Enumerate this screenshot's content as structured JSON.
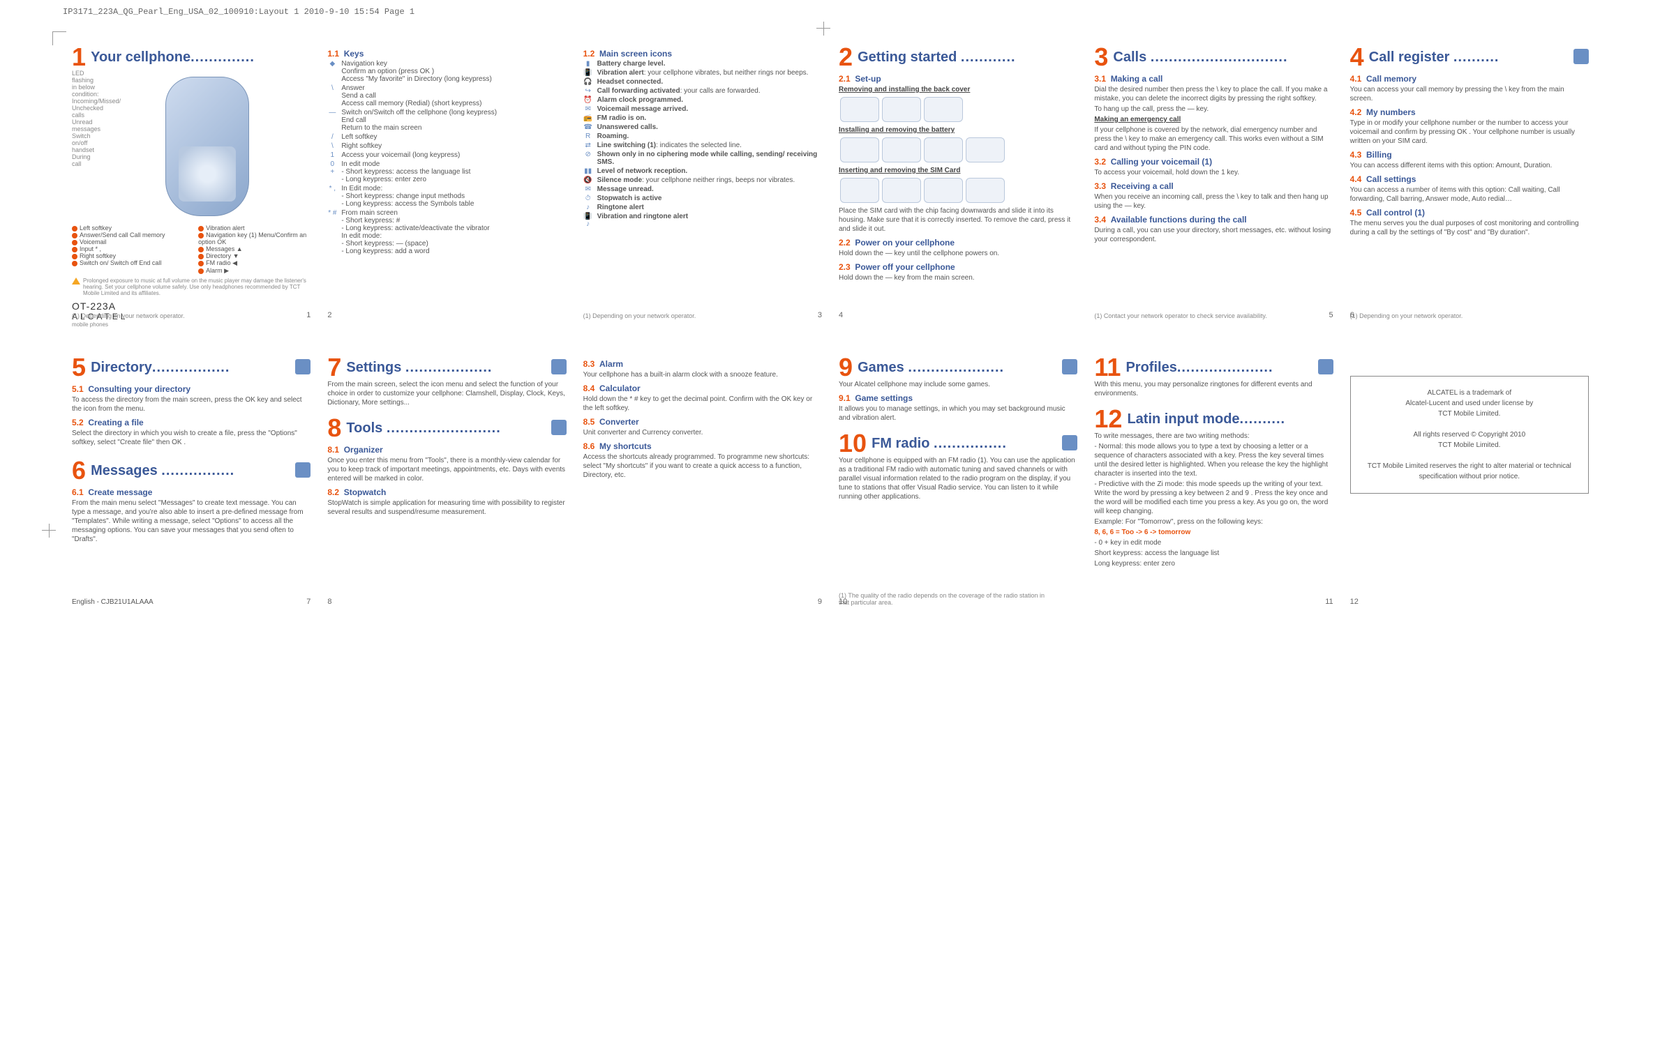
{
  "header": "IP3171_223A_QG_Pearl_Eng_USA_02_100910:Layout 1  2010-9-10  15:54  Page 1",
  "sections": {
    "s1": {
      "num": "1",
      "title": "Your cellphone",
      "dots": ".............."
    },
    "s1_1": {
      "num": "1.1",
      "title": "Keys"
    },
    "s1_2": {
      "num": "1.2",
      "title": "Main screen icons"
    },
    "s2": {
      "num": "2",
      "title": "Getting started",
      "dots": "............"
    },
    "s2_1": {
      "num": "2.1",
      "title": "Set-up"
    },
    "s2_1a": "Removing and installing the back cover",
    "s2_1b": "Installing and removing the battery",
    "s2_1c": "Inserting and removing the SIM Card",
    "s2_1d": "Place the SIM card with the chip facing downwards and slide it into its housing. Make sure that it is correctly inserted. To remove the card, press it and slide it out.",
    "s2_2": {
      "num": "2.2",
      "title": "Power on your cellphone"
    },
    "s2_2t": "Hold down the — key until the cellphone powers on.",
    "s2_3": {
      "num": "2.3",
      "title": "Power off your cellphone"
    },
    "s2_3t": "Hold down the — key from the main screen.",
    "s3": {
      "num": "3",
      "title": "Calls",
      "dots": ".............................."
    },
    "s3_1": {
      "num": "3.1",
      "title": "Making a call"
    },
    "s3_1t": "Dial the desired number then press the \\ key to place the call. If you make a mistake, you can delete the incorrect digits by pressing the right softkey.",
    "s3_1u": "To hang up the call, press the — key.",
    "s3_1v": "Making an emergency call",
    "s3_1w": "If your cellphone is covered by the network, dial emergency number and press the \\ key to make an emergency call. This works even without a SIM card and without typing the PIN code.",
    "s3_2": {
      "num": "3.2",
      "title": "Calling your voicemail (1)"
    },
    "s3_2t": "To access your voicemail, hold down the 1 key.",
    "s3_3": {
      "num": "3.3",
      "title": "Receiving a call"
    },
    "s3_3t": "When you receive an incoming call, press the \\ key to talk and then hang up using the — key.",
    "s3_4": {
      "num": "3.4",
      "title": "Available functions during the call"
    },
    "s3_4t": "During a call, you can use your directory, short messages, etc. without losing your correspondent.",
    "s4": {
      "num": "4",
      "title": "Call register",
      "dots": ".........."
    },
    "s4_1": {
      "num": "4.1",
      "title": "Call memory"
    },
    "s4_1t": "You can access your call memory by pressing the \\ key from the main screen.",
    "s4_2": {
      "num": "4.2",
      "title": "My numbers"
    },
    "s4_2t": "Type in or modify your cellphone number or the number to access your voicemail and confirm by pressing OK . Your cellphone number is usually written on your SIM card.",
    "s4_3": {
      "num": "4.3",
      "title": "Billing"
    },
    "s4_3t": "You can access different items with this option: Amount, Duration.",
    "s4_4": {
      "num": "4.4",
      "title": "Call settings"
    },
    "s4_4t": "You can access a number of items with this option: Call waiting, Call forwarding, Call barring, Answer mode, Auto redial…",
    "s4_5": {
      "num": "4.5",
      "title": "Call control (1)"
    },
    "s4_5t": "The menu serves you the dual purposes of cost monitoring and controlling during a call by the settings of \"By cost\" and \"By duration\".",
    "s5": {
      "num": "5",
      "title": "Directory",
      "dots": "................."
    },
    "s5_1": {
      "num": "5.1",
      "title": "Consulting your directory"
    },
    "s5_1t": "To access the directory from the main screen, press the OK key and select the icon from the menu.",
    "s5_2": {
      "num": "5.2",
      "title": "Creating a file"
    },
    "s5_2t": "Select the directory in which you wish to create a file, press the \"Options\" softkey, select \"Create file\" then OK .",
    "s6": {
      "num": "6",
      "title": "Messages",
      "dots": "................"
    },
    "s6_1": {
      "num": "6.1",
      "title": "Create message"
    },
    "s6_1t": "From the main menu select \"Messages\" to create text message. You can type a message, and you're also able to insert a pre-defined message from \"Templates\". While writing a message, select \"Options\" to access all the messaging options. You can save your messages that you send often to \"Drafts\".",
    "s7": {
      "num": "7",
      "title": "Settings",
      "dots": "..................."
    },
    "s7t": "From the main screen, select the icon menu and select the function of your choice in order to customize your cellphone: Clamshell, Display, Clock, Keys, Dictionary, More settings...",
    "s8": {
      "num": "8",
      "title": "Tools",
      "dots": "........................."
    },
    "s8_1": {
      "num": "8.1",
      "title": "Organizer"
    },
    "s8_1t": "Once you enter this menu from \"Tools\", there is a monthly-view calendar for you to keep track of important meetings, appointments, etc. Days with events entered will be marked in color.",
    "s8_2": {
      "num": "8.2",
      "title": "Stopwatch"
    },
    "s8_2t": "StopWatch is simple application for measuring time with possibility to register several results and suspend/resume measurement.",
    "s8_3": {
      "num": "8.3",
      "title": "Alarm"
    },
    "s8_3t": "Your cellphone has a built-in alarm clock with a snooze feature.",
    "s8_4": {
      "num": "8.4",
      "title": "Calculator"
    },
    "s8_4t": "Hold down the * # key to get the decimal point. Confirm with the OK key or the left softkey.",
    "s8_5": {
      "num": "8.5",
      "title": "Converter"
    },
    "s8_5t": "Unit converter and Currency converter.",
    "s8_6": {
      "num": "8.6",
      "title": "My shortcuts"
    },
    "s8_6t": "Access the shortcuts already programmed. To programme new shortcuts: select \"My shortcuts\" if you want to create a quick access to a function, Directory, etc.",
    "s9": {
      "num": "9",
      "title": "Games",
      "dots": "....................."
    },
    "s9t": "Your Alcatel cellphone may include some games.",
    "s9_1": {
      "num": "9.1",
      "title": "Game settings"
    },
    "s9_1t": "It allows you to manage settings, in which you may set background music and vibration alert.",
    "s10": {
      "num": "10",
      "title": "FM radio",
      "dots": "................"
    },
    "s10t": "Your cellphone is equipped with an FM radio (1). You can use the application as a traditional FM radio with automatic tuning and saved channels or with parallel visual information related to the radio program on the display, if you tune to stations that offer Visual Radio service. You can listen to it while running other applications.",
    "s11": {
      "num": "11",
      "title": "Profiles",
      "dots": "....................."
    },
    "s11t": "With this menu, you may personalize ringtones for different events and environments.",
    "s12": {
      "num": "12",
      "title": "Latin input mode",
      "dots": ".........."
    },
    "s12t1": "To write messages, there are two writing methods:",
    "s12t2": "Normal: this mode allows you to type a text by choosing a letter or a sequence of characters associated with a key. Press the key several times until the desired letter is highlighted. When you release the key the highlight character is inserted into the text.",
    "s12t3": "Predictive with the Zi mode: this mode speeds up the writing of your text. Write the word by pressing a key between 2 and 9 . Press the key once and the word will be modified each time you press a key. As you go on, the word will keep changing.",
    "s12t4": "Example: For \"Tomorrow\", press on the following keys:",
    "s12t5": "8, 6, 6 = Too -> 6 -> tomorrow",
    "s12t6": "0 + key in edit mode",
    "s12t7": "Short keypress: access the language list",
    "s12t8": "Long keypress: enter zero"
  },
  "keys11": [
    {
      "ic": "◆",
      "tx": "Navigation key\nConfirm an option (press OK )\nAccess \"My favorite\" in Directory (long keypress)"
    },
    {
      "ic": "\\",
      "tx": "Answer\nSend a call\nAccess call memory (Redial) (short keypress)"
    },
    {
      "ic": "—",
      "tx": "Switch on/Switch off the cellphone (long keypress)\nEnd call\nReturn to the main screen"
    },
    {
      "ic": "/",
      "tx": "Left softkey"
    },
    {
      "ic": "\\",
      "tx": "Right softkey"
    },
    {
      "ic": "1",
      "tx": "Access your voicemail (long keypress)"
    },
    {
      "ic": "0 +",
      "tx": "In edit mode\n- Short keypress: access the language list\n- Long keypress: enter zero"
    },
    {
      "ic": "* ,",
      "tx": "In Edit mode:\n- Short keypress: change input methods\n- Long keypress: access the Symbols table"
    },
    {
      "ic": "* #",
      "tx": "From main screen\n- Short keypress: #\n- Long keypress: activate/deactivate the vibrator\nIn edit mode:\n- Short keypress: — (space)\n- Long keypress: add a word"
    }
  ],
  "icons12": [
    {
      "ic": "▮",
      "tx": "Battery charge level."
    },
    {
      "ic": "📳",
      "tx": "Vibration alert: your cellphone vibrates, but neither rings nor beeps."
    },
    {
      "ic": "🎧",
      "tx": "Headset connected."
    },
    {
      "ic": "↪",
      "tx": "Call forwarding activated: your calls are forwarded."
    },
    {
      "ic": "⏰",
      "tx": "Alarm clock programmed."
    },
    {
      "ic": "✉",
      "tx": "Voicemail message arrived."
    },
    {
      "ic": "📻",
      "tx": "FM radio is on."
    },
    {
      "ic": "☎",
      "tx": "Unanswered calls."
    },
    {
      "ic": "R",
      "tx": "Roaming."
    },
    {
      "ic": "⇄",
      "tx": "Line switching (1): indicates the selected line."
    },
    {
      "ic": "⊘",
      "tx": "Shown only in no ciphering mode while calling, sending/ receiving SMS."
    },
    {
      "ic": "▮▮",
      "tx": "Level of network reception."
    },
    {
      "ic": "🔇",
      "tx": "Silence mode: your cellphone neither rings, beeps nor vibrates."
    },
    {
      "ic": "✉",
      "tx": "Message unread."
    },
    {
      "ic": "⏱",
      "tx": "Stopwatch is active"
    },
    {
      "ic": "♪",
      "tx": "Ringtone alert"
    },
    {
      "ic": "📳♪",
      "tx": "Vibration and ringtone alert"
    }
  ],
  "legend_left": [
    "Left softkey",
    "Answer/Send call\nCall memory",
    "Voicemail",
    "Input * ,",
    "Right softkey",
    "Switch on/\nSwitch off\nEnd call"
  ],
  "legend_right": [
    "Vibration alert",
    "Navigation key (1)\nMenu/Confirm an option OK",
    "Messages ▲",
    "Directory ▼",
    "FM radio ◀",
    "Alarm ▶"
  ],
  "led_text": "LED flashing in below condition:\nIncoming/Missed/\nUnchecked calls\nUnread messages\nSwitch on/off handset\nDuring call",
  "warning": "Prolonged exposure to music at full volume on the music player may damage the listener's hearing. Set your cellphone volume safely. Use only headphones recommended by TCT Mobile Limited and its affiliates.",
  "model": "OT-223A",
  "brand": "ALCATEL",
  "brandsub": "mobile phones",
  "foot1a": "(1)  Depending on your network operator.",
  "foot1b": "(1)  Depending on your network operator.",
  "foot3": "(1)  Contact your network operator to check service availability.",
  "foot4": "(1)  Depending on your network operator.",
  "foot10": "(1)  The quality of the radio depends on the coverage of the radio station in that particular area.",
  "trademark": {
    "l1": "ALCATEL is a trademark of",
    "l2": "Alcatel-Lucent and used under license by",
    "l3": "TCT Mobile Limited.",
    "l4": "All rights reserved © Copyright 2010",
    "l5": "TCT Mobile Limited.",
    "l6": "TCT Mobile Limited reserves the right to alter material or technical specification without prior notice."
  },
  "english_code": "English - CJB21U1ALAAA",
  "pgnums": [
    "1",
    "2",
    "3",
    "4",
    "5",
    "6",
    "7",
    "8",
    "9",
    "10",
    "11",
    "12"
  ]
}
